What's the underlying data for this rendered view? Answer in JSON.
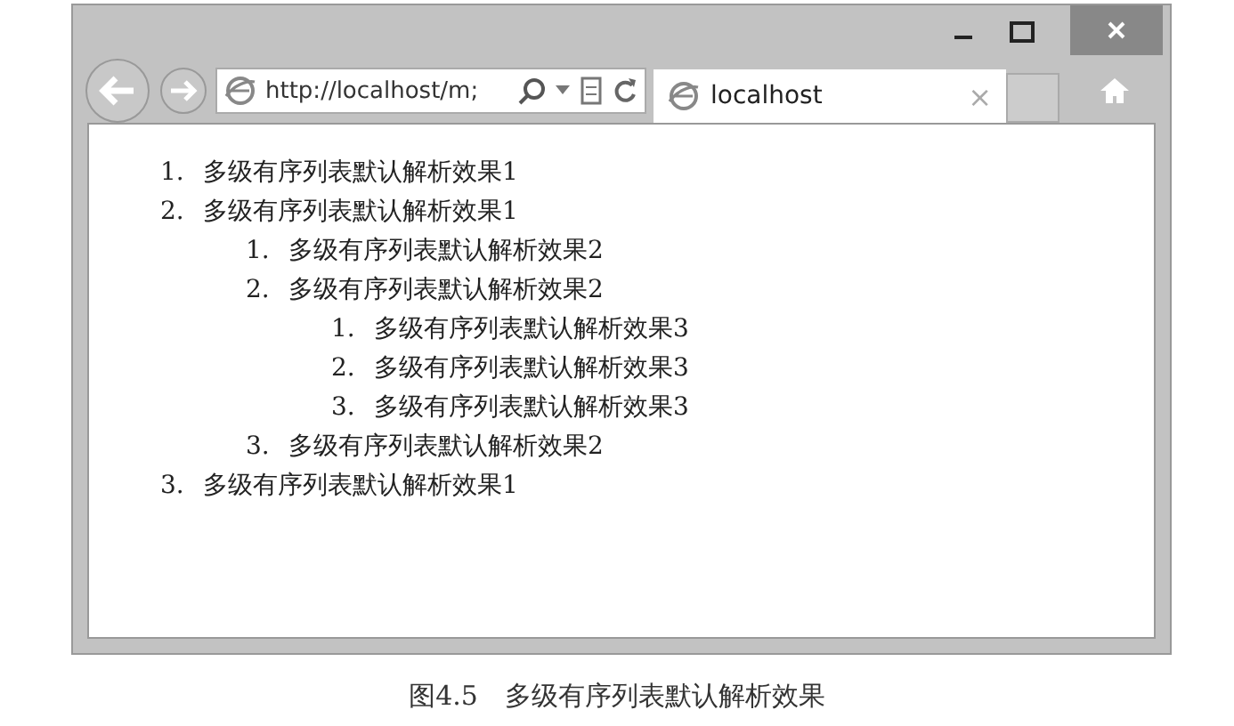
{
  "window": {
    "title_buttons": [
      {
        "kind": "minimize"
      },
      {
        "kind": "maximize"
      },
      {
        "kind": "close"
      }
    ]
  },
  "address_bar": {
    "value": "http://localhost/m;"
  },
  "tab": {
    "title": "localhost",
    "close": "×"
  },
  "list": [
    {
      "marker": "1.",
      "text": "多级有序列表默认解析效果1"
    },
    {
      "marker": "2.",
      "text": "多级有序列表默认解析效果1",
      "children": [
        {
          "marker": "1.",
          "text": "多级有序列表默认解析效果2"
        },
        {
          "marker": "2.",
          "text": "多级有序列表默认解析效果2",
          "children": [
            {
              "marker": "1.",
              "text": "多级有序列表默认解析效果3"
            },
            {
              "marker": "2.",
              "text": "多级有序列表默认解析效果3"
            },
            {
              "marker": "3.",
              "text": "多级有序列表默认解析效果3"
            }
          ]
        },
        {
          "marker": "3.",
          "text": "多级有序列表默认解析效果2"
        }
      ]
    },
    {
      "marker": "3.",
      "text": "多级有序列表默认解析效果1"
    }
  ],
  "caption": "图4.5　多级有序列表默认解析效果"
}
